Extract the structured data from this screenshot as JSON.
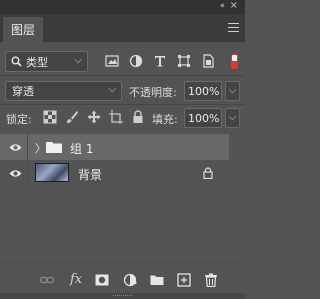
{
  "panel": {
    "tab_label": "图层",
    "collapse_glyph": "‹‹",
    "close_glyph": "×"
  },
  "filter": {
    "kind_label": "类型",
    "icons": [
      "pixel-filter-icon",
      "adjustment-filter-icon",
      "type-filter-icon",
      "shape-filter-icon",
      "smart-object-filter-icon"
    ],
    "filter_toggle_color": "#e03a2a"
  },
  "blend": {
    "mode": "穿透",
    "opacity_label": "不透明度:",
    "opacity_value": "100%"
  },
  "lock": {
    "label": "锁定:",
    "icons": [
      "lock-transparent-icon",
      "lock-image-icon",
      "lock-position-icon",
      "lock-artboard-icon",
      "lock-all-icon"
    ],
    "fill_label": "填充:",
    "fill_value": "100%"
  },
  "layers": [
    {
      "name": "组 1",
      "type": "group",
      "visible": true,
      "selected": true
    },
    {
      "name": "背景",
      "type": "background",
      "visible": true,
      "locked": true
    }
  ],
  "bottom": {
    "icons": [
      "link-layers-icon",
      "fx-icon",
      "add-mask-icon",
      "new-adjustment-icon",
      "new-group-icon",
      "new-layer-icon",
      "delete-layer-icon"
    ],
    "fx_label": "fx"
  }
}
